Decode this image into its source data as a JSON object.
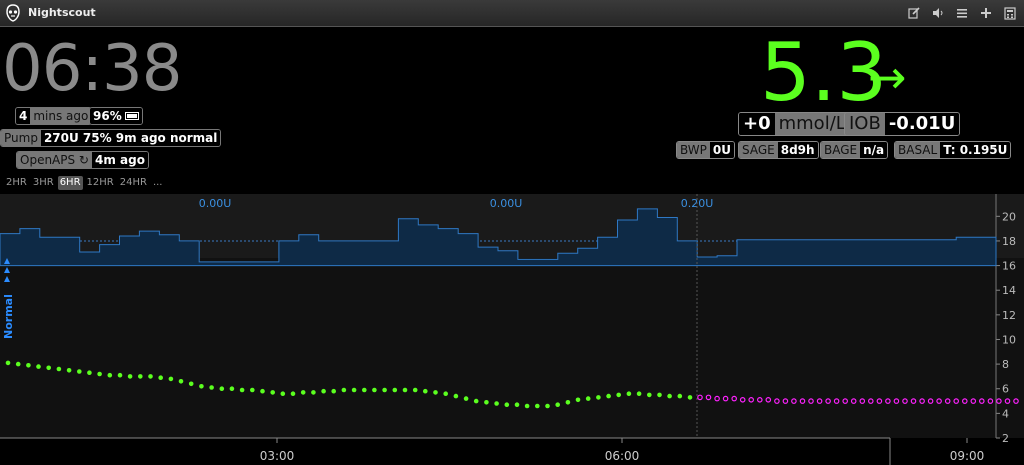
{
  "app": {
    "title": "Nightscout"
  },
  "toolbar": {
    "icons": [
      "edit-icon",
      "speaker-icon",
      "menu-icon",
      "plus-icon",
      "calculator-icon"
    ]
  },
  "clock": "06:38",
  "status": {
    "last_reading": {
      "value": "4",
      "label": "mins ago"
    },
    "battery": {
      "value": "96%"
    },
    "pump": {
      "label": "Pump",
      "value": "270U 75% 9m ago normal"
    },
    "openaps": {
      "label": "OpenAPS ↻",
      "value": "4m ago"
    }
  },
  "time_ranges": [
    "2HR",
    "3HR",
    "6HR",
    "12HR",
    "24HR",
    "..."
  ],
  "active_range": "6HR",
  "bg": {
    "value": "5.3",
    "arrow": "→",
    "color": "#5bff1f"
  },
  "delta": {
    "value": "+0",
    "unit": "mmol/L"
  },
  "iob": {
    "label": "IOB",
    "value": "-0.01U"
  },
  "pills": [
    {
      "label": "BWP",
      "value": "0U"
    },
    {
      "label": "SAGE",
      "value": "8d9h"
    },
    {
      "label": "BAGE",
      "value": "n/a"
    },
    {
      "label": "BASAL",
      "value": "T: 0.195U"
    }
  ],
  "chart_data": {
    "type": "scatter",
    "xlabel": "",
    "ylabel": "",
    "x_ticks": [
      "03:00",
      "06:00",
      "09:00"
    ],
    "y_ticks": [
      2,
      4,
      6,
      8,
      10,
      12,
      14,
      16,
      18,
      20
    ],
    "ylim": [
      2,
      21
    ],
    "range_label": "Normal",
    "bolus_labels": [
      "0.00U",
      "0.00U",
      "0.20U"
    ],
    "series": [
      {
        "color": "#5bff1f",
        "values": [
          8.1,
          8.0,
          7.9,
          7.8,
          7.7,
          7.6,
          7.5,
          7.4,
          7.3,
          7.2,
          7.1,
          7.1,
          7.0,
          7.0,
          7.0,
          6.9,
          6.8,
          6.6,
          6.4,
          6.2,
          6.1,
          6.0,
          6.0,
          5.9,
          5.9,
          5.8,
          5.7,
          5.6,
          5.6,
          5.7,
          5.7,
          5.8,
          5.8,
          5.9,
          5.9,
          5.9,
          5.9,
          5.9,
          5.9,
          5.9,
          5.9,
          5.8,
          5.7,
          5.6,
          5.4,
          5.2,
          5.0,
          4.9,
          4.8,
          4.7,
          4.7,
          4.6,
          4.6,
          4.6,
          4.7,
          4.9,
          5.1,
          5.2,
          5.3,
          5.4,
          5.5,
          5.6,
          5.6,
          5.5,
          5.5,
          5.4,
          5.4,
          5.3
        ]
      },
      {
        "color": "#ff22ff",
        "values": [
          5.3,
          5.3,
          5.2,
          5.2,
          5.2,
          5.1,
          5.1,
          5.1,
          5.1,
          5.0,
          5.0,
          5.0,
          5.0,
          5.0,
          5.0,
          5.0,
          5.0,
          5.0,
          5.0,
          5.0,
          5.0,
          5.0,
          5.0,
          5.0,
          5.0,
          5.0,
          5.0,
          5.0,
          5.0,
          5.0,
          5.0,
          5.0,
          5.0,
          5.0,
          5.0,
          5.0,
          5.0,
          5.0
        ]
      }
    ],
    "basal": [
      18.6,
      19.0,
      18.3,
      18.3,
      17.1,
      17.7,
      18.4,
      18.8,
      18.5,
      18.0,
      16.3,
      16.3,
      16.3,
      16.3,
      18.0,
      18.5,
      18.0,
      18.0,
      18.0,
      18.0,
      19.8,
      19.3,
      19.0,
      18.6,
      17.5,
      17.2,
      16.5,
      16.5,
      17.0,
      17.4,
      18.3,
      19.7,
      20.6,
      19.9,
      18.0,
      16.7,
      16.8,
      18.1,
      18.1,
      18.1,
      18.1,
      18.1,
      18.1,
      18.1,
      18.1,
      18.1,
      18.1,
      18.1,
      18.3,
      18.3
    ]
  }
}
